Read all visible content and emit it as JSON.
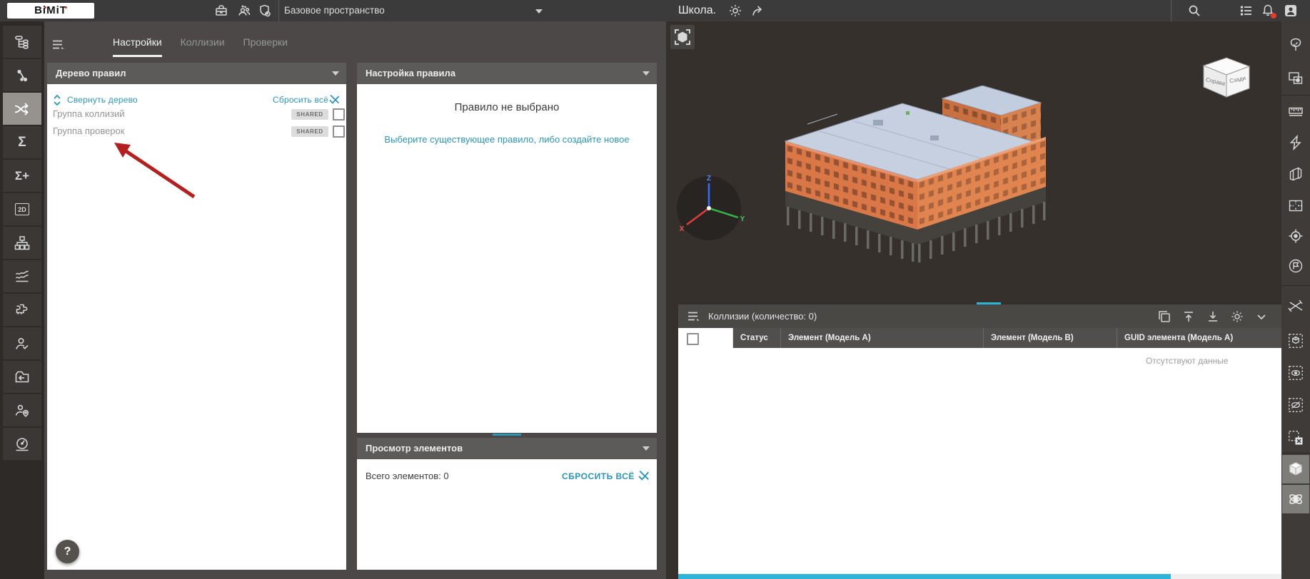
{
  "topbar": {
    "logo": "BiMiT",
    "workspace_selector": "Базовое пространство",
    "project_title": "Школа.",
    "icons": [
      "briefcase-icon",
      "team-icon",
      "shield-status-icon",
      "settings-gear-icon",
      "share-icon",
      "search-icon",
      "menu-list-icon",
      "notifications-bell-icon",
      "account-icon"
    ]
  },
  "left_toolbar": {
    "icons": [
      "model-tree",
      "relations",
      "collisions-shuffle",
      "sum",
      "sum-add",
      "view-2d",
      "structure",
      "charts",
      "plugins",
      "user-check",
      "export-folder",
      "user-location",
      "dashboard"
    ],
    "active_item": "collisions-shuffle",
    "glyph_sum": "Σ",
    "glyph_sum_add": "Σ+",
    "glyph_2d": "2D",
    "help_label": "?"
  },
  "tool_panel": {
    "tabs": [
      {
        "label": "Настройки",
        "active": true
      },
      {
        "label": "Коллизии",
        "active": false
      },
      {
        "label": "Проверки",
        "active": false
      }
    ],
    "rule_tree": {
      "title": "Дерево правил",
      "collapse_link": "Свернуть дерево",
      "reset_link": "Сбросить всё",
      "items": [
        {
          "label": "Группа коллизий",
          "badge": "SHARED",
          "checked": false
        },
        {
          "label": "Группа проверок",
          "badge": "SHARED",
          "checked": false
        }
      ]
    },
    "rule_settings": {
      "title": "Настройка правила",
      "empty_title": "Правило не выбрано",
      "empty_hint": "Выберите существующее правило, либо создайте новое"
    },
    "elements_view": {
      "title": "Просмотр элементов",
      "total": "Всего элементов: 0",
      "reset_link": "СБРОСИТЬ ВСЁ"
    }
  },
  "viewport": {
    "nav_cube_faces": [
      "Справа",
      "Сзади"
    ],
    "axis_labels": {
      "x": "X",
      "y": "Y",
      "z": "Z"
    }
  },
  "collisions": {
    "title": "Коллизии (количество: 0)",
    "columns": [
      "Статус",
      "Элемент (Модель A)",
      "Элемент (Модель B)",
      "GUID элемента (Модель A)"
    ],
    "empty_text": "Отсутствуют данные",
    "toolbar_icons": [
      "duplicate-icon",
      "import-icon",
      "export-icon",
      "table-settings-icon",
      "collapse-chevron-icon"
    ]
  },
  "colors": {
    "accent_link": "#2f94b5",
    "scrollbar": "#2fb4d9",
    "building_wall": "#d97747",
    "annotation_arrow": "#b32020",
    "active_tool": "#96938f"
  }
}
